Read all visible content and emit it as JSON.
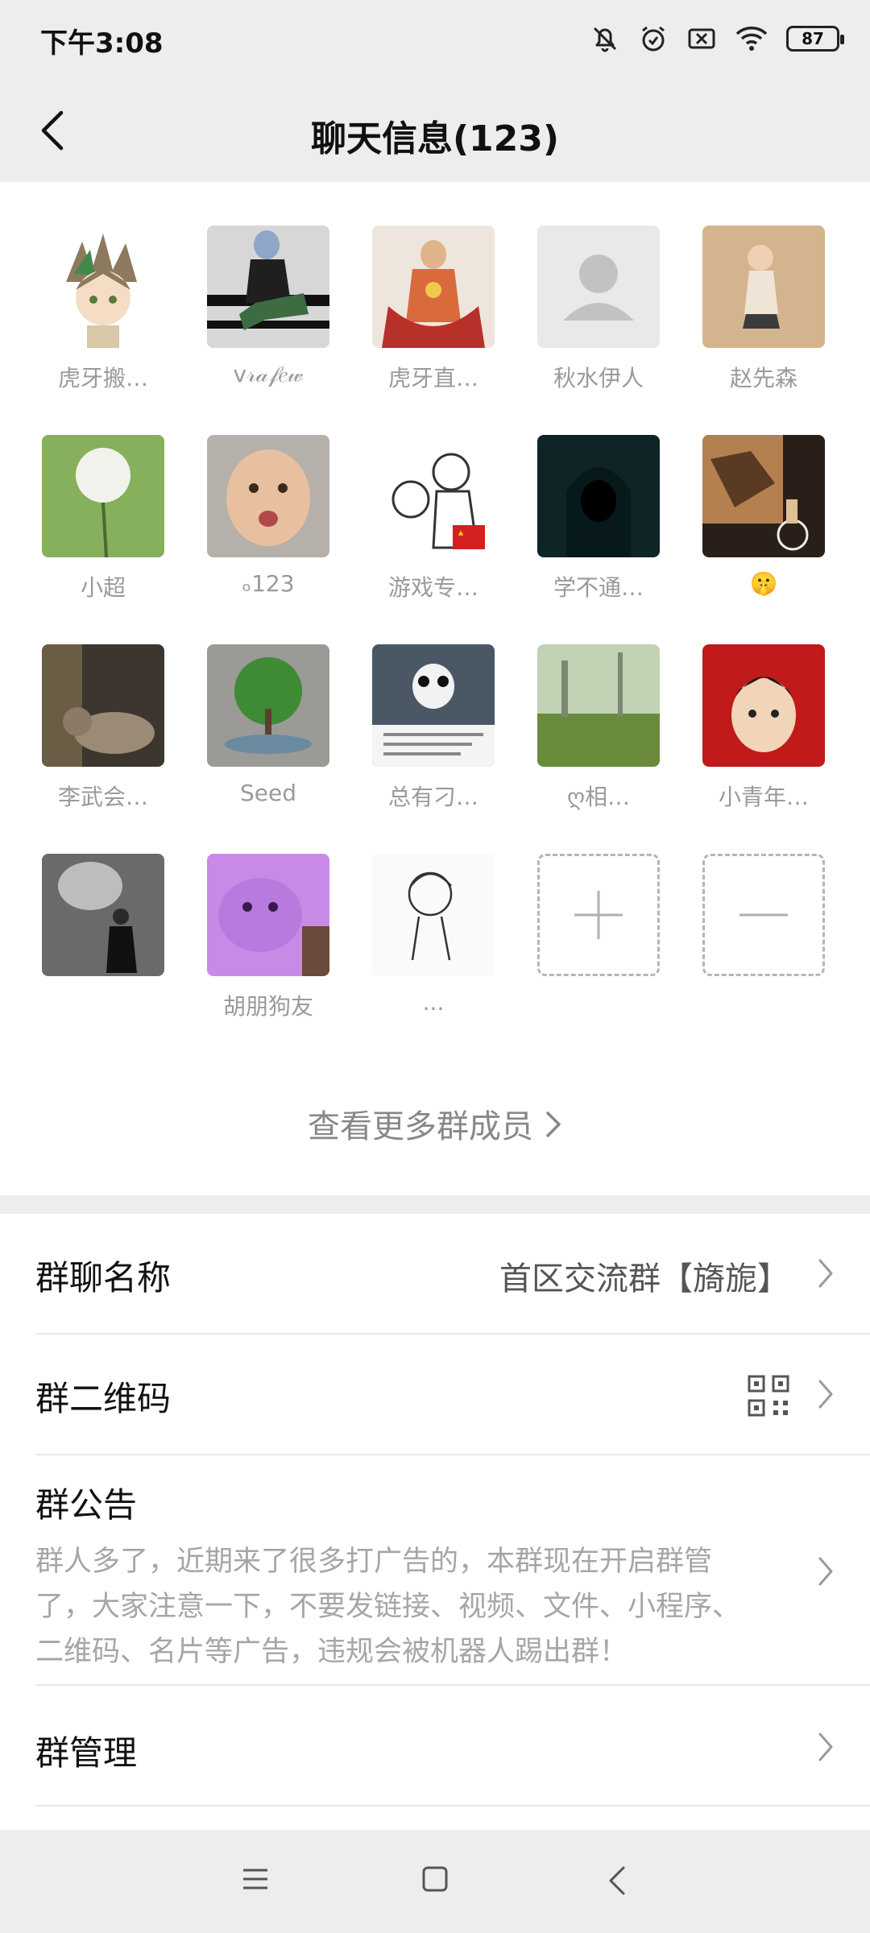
{
  "status": {
    "time": "下午3:08",
    "battery": "87",
    "icons": [
      "bell-muted-icon",
      "alarm-icon",
      "sim-x-icon",
      "wifi-icon",
      "battery-icon"
    ]
  },
  "header": {
    "title": "聊天信息(123)",
    "back_icon": "chevron-left-icon"
  },
  "members": [
    {
      "name": "虎牙搬…",
      "color": "#c8b9a0"
    },
    {
      "name": "v𝓇𝒶𝒻𝑒𝓌",
      "color": "#3a4a3a"
    },
    {
      "name": "虎牙直…",
      "color": "#c86a4a"
    },
    {
      "name": "秋水伊人",
      "color": "#e6e6e6"
    },
    {
      "name": "赵先森",
      "color": "#d6b896"
    },
    {
      "name": "小超",
      "color": "#7fae5a"
    },
    {
      "name": "ₒ123",
      "color": "#c9a88c"
    },
    {
      "name": "游戏专…",
      "color": "#f4f4f4"
    },
    {
      "name": "学不通…",
      "color": "#1c3a3c"
    },
    {
      "name": "🤫",
      "color": "#8a5a32"
    },
    {
      "name": "李武会…",
      "color": "#4a4238"
    },
    {
      "name": "Seed",
      "color": "#6a9a5a"
    },
    {
      "name": "总有刁…",
      "color": "#3a4a5a"
    },
    {
      "name": "ღ相…",
      "color": "#7a9a62"
    },
    {
      "name": "小青年…",
      "color": "#c21e1e"
    },
    {
      "name": "",
      "color": "#8e8e8e"
    },
    {
      "name": "胡朋狗友",
      "color": "#b07ad8"
    },
    {
      "name": "...",
      "color": "#fafafa"
    }
  ],
  "more_members": "查看更多群成员",
  "settings": {
    "group_name_label": "群聊名称",
    "group_name_value": "首区交流群【旖旎】",
    "qr_label": "群二维码",
    "notice_label": "群公告",
    "notice_text": "群人多了，近期来了很多打广告的，本群现在开启群管了，大家注意一下，不要发链接、视频、文件、小程序、二维码、名片等广告，违规会被机器人踢出群！",
    "manage_label": "群管理"
  },
  "colors": {
    "background": "#ededed",
    "panel": "#ffffff",
    "muted_text": "#9a9a9a"
  }
}
